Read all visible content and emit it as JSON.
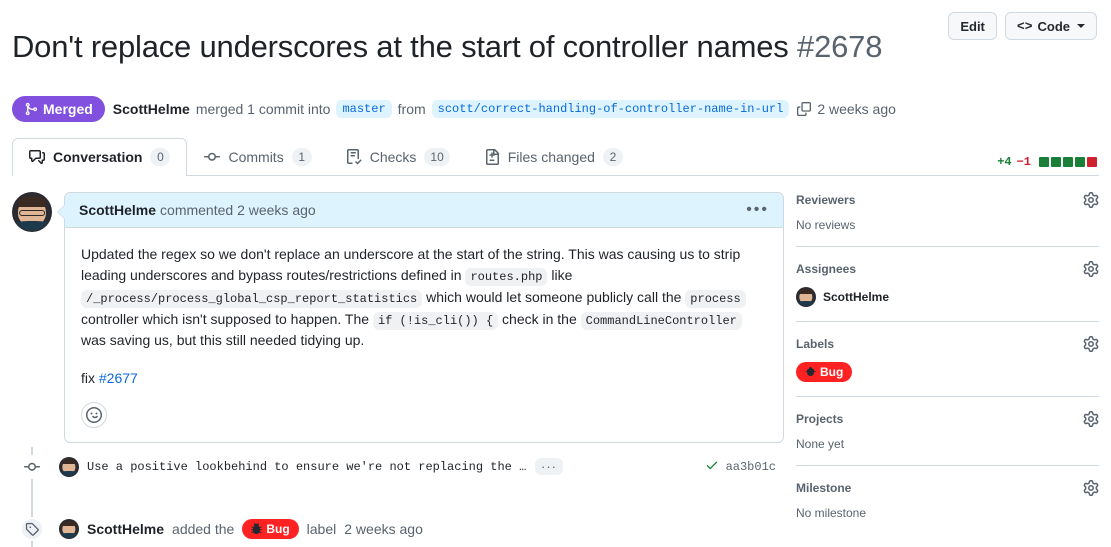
{
  "header": {
    "title": "Don't replace underscores at the start of controller names",
    "number": "#2678",
    "edit_label": "Edit",
    "code_label": "Code"
  },
  "status": {
    "state": "Merged",
    "author": "ScottHelme",
    "merged_text": "merged 1 commit into",
    "base_branch": "master",
    "from_text": "from",
    "head_branch": "scott/correct-handling-of-controller-name-in-url",
    "time": "2 weeks ago"
  },
  "tabs": [
    {
      "label": "Conversation",
      "count": "0",
      "icon": "comment-discussion-icon",
      "active": true
    },
    {
      "label": "Commits",
      "count": "1",
      "icon": "git-commit-icon",
      "active": false
    },
    {
      "label": "Checks",
      "count": "10",
      "icon": "checklist-icon",
      "active": false
    },
    {
      "label": "Files changed",
      "count": "2",
      "icon": "file-diff-icon",
      "active": false
    }
  ],
  "diffstat": {
    "additions": "+4",
    "deletions": "−1",
    "blocks": [
      "#1a7f37",
      "#1a7f37",
      "#1a7f37",
      "#1a7f37",
      "#cf222e"
    ]
  },
  "comment": {
    "author": "ScottHelme",
    "action": "commented",
    "time": "2 weeks ago",
    "paragraph1_a": "Updated the regex so we don't replace an underscore at the start of the string. This was causing us to strip leading underscores and bypass routes/restrictions defined in ",
    "code_routes": "routes.php",
    "paragraph1_b": " like ",
    "code_path": "/_process/process_global_csp_report_statistics",
    "paragraph1_c": " which would let someone publicly call the ",
    "code_process": "process",
    "paragraph1_d": " controller which isn't supposed to happen. The ",
    "code_iscli": "if (!is_cli()) {",
    "paragraph1_e": " check in the ",
    "code_clc": "CommandLineController",
    "paragraph1_f": " was saving us, but this still needed tidying up.",
    "fix_prefix": "fix ",
    "fix_issue": "#2677"
  },
  "timeline": {
    "commit": {
      "message": "Use a positive lookbehind to ensure we're not replacing the first cha…",
      "expand": "···",
      "sha": "aa3b01c"
    },
    "label_event": {
      "actor": "ScottHelme",
      "added_the": "added the",
      "label": "Bug",
      "label_suffix": "label",
      "time": "2 weeks ago"
    }
  },
  "sidebar": {
    "reviewers": {
      "title": "Reviewers",
      "empty": "No reviews"
    },
    "assignees": {
      "title": "Assignees",
      "person": "ScottHelme"
    },
    "labels": {
      "title": "Labels",
      "label": "Bug"
    },
    "projects": {
      "title": "Projects",
      "empty": "None yet"
    },
    "milestone": {
      "title": "Milestone",
      "empty": "No milestone"
    }
  },
  "colors": {
    "merged_purple": "#8250df",
    "label_red": "#ff2222",
    "link_blue": "#0969da",
    "add_green": "#1a7f37",
    "del_red": "#cf222e"
  }
}
